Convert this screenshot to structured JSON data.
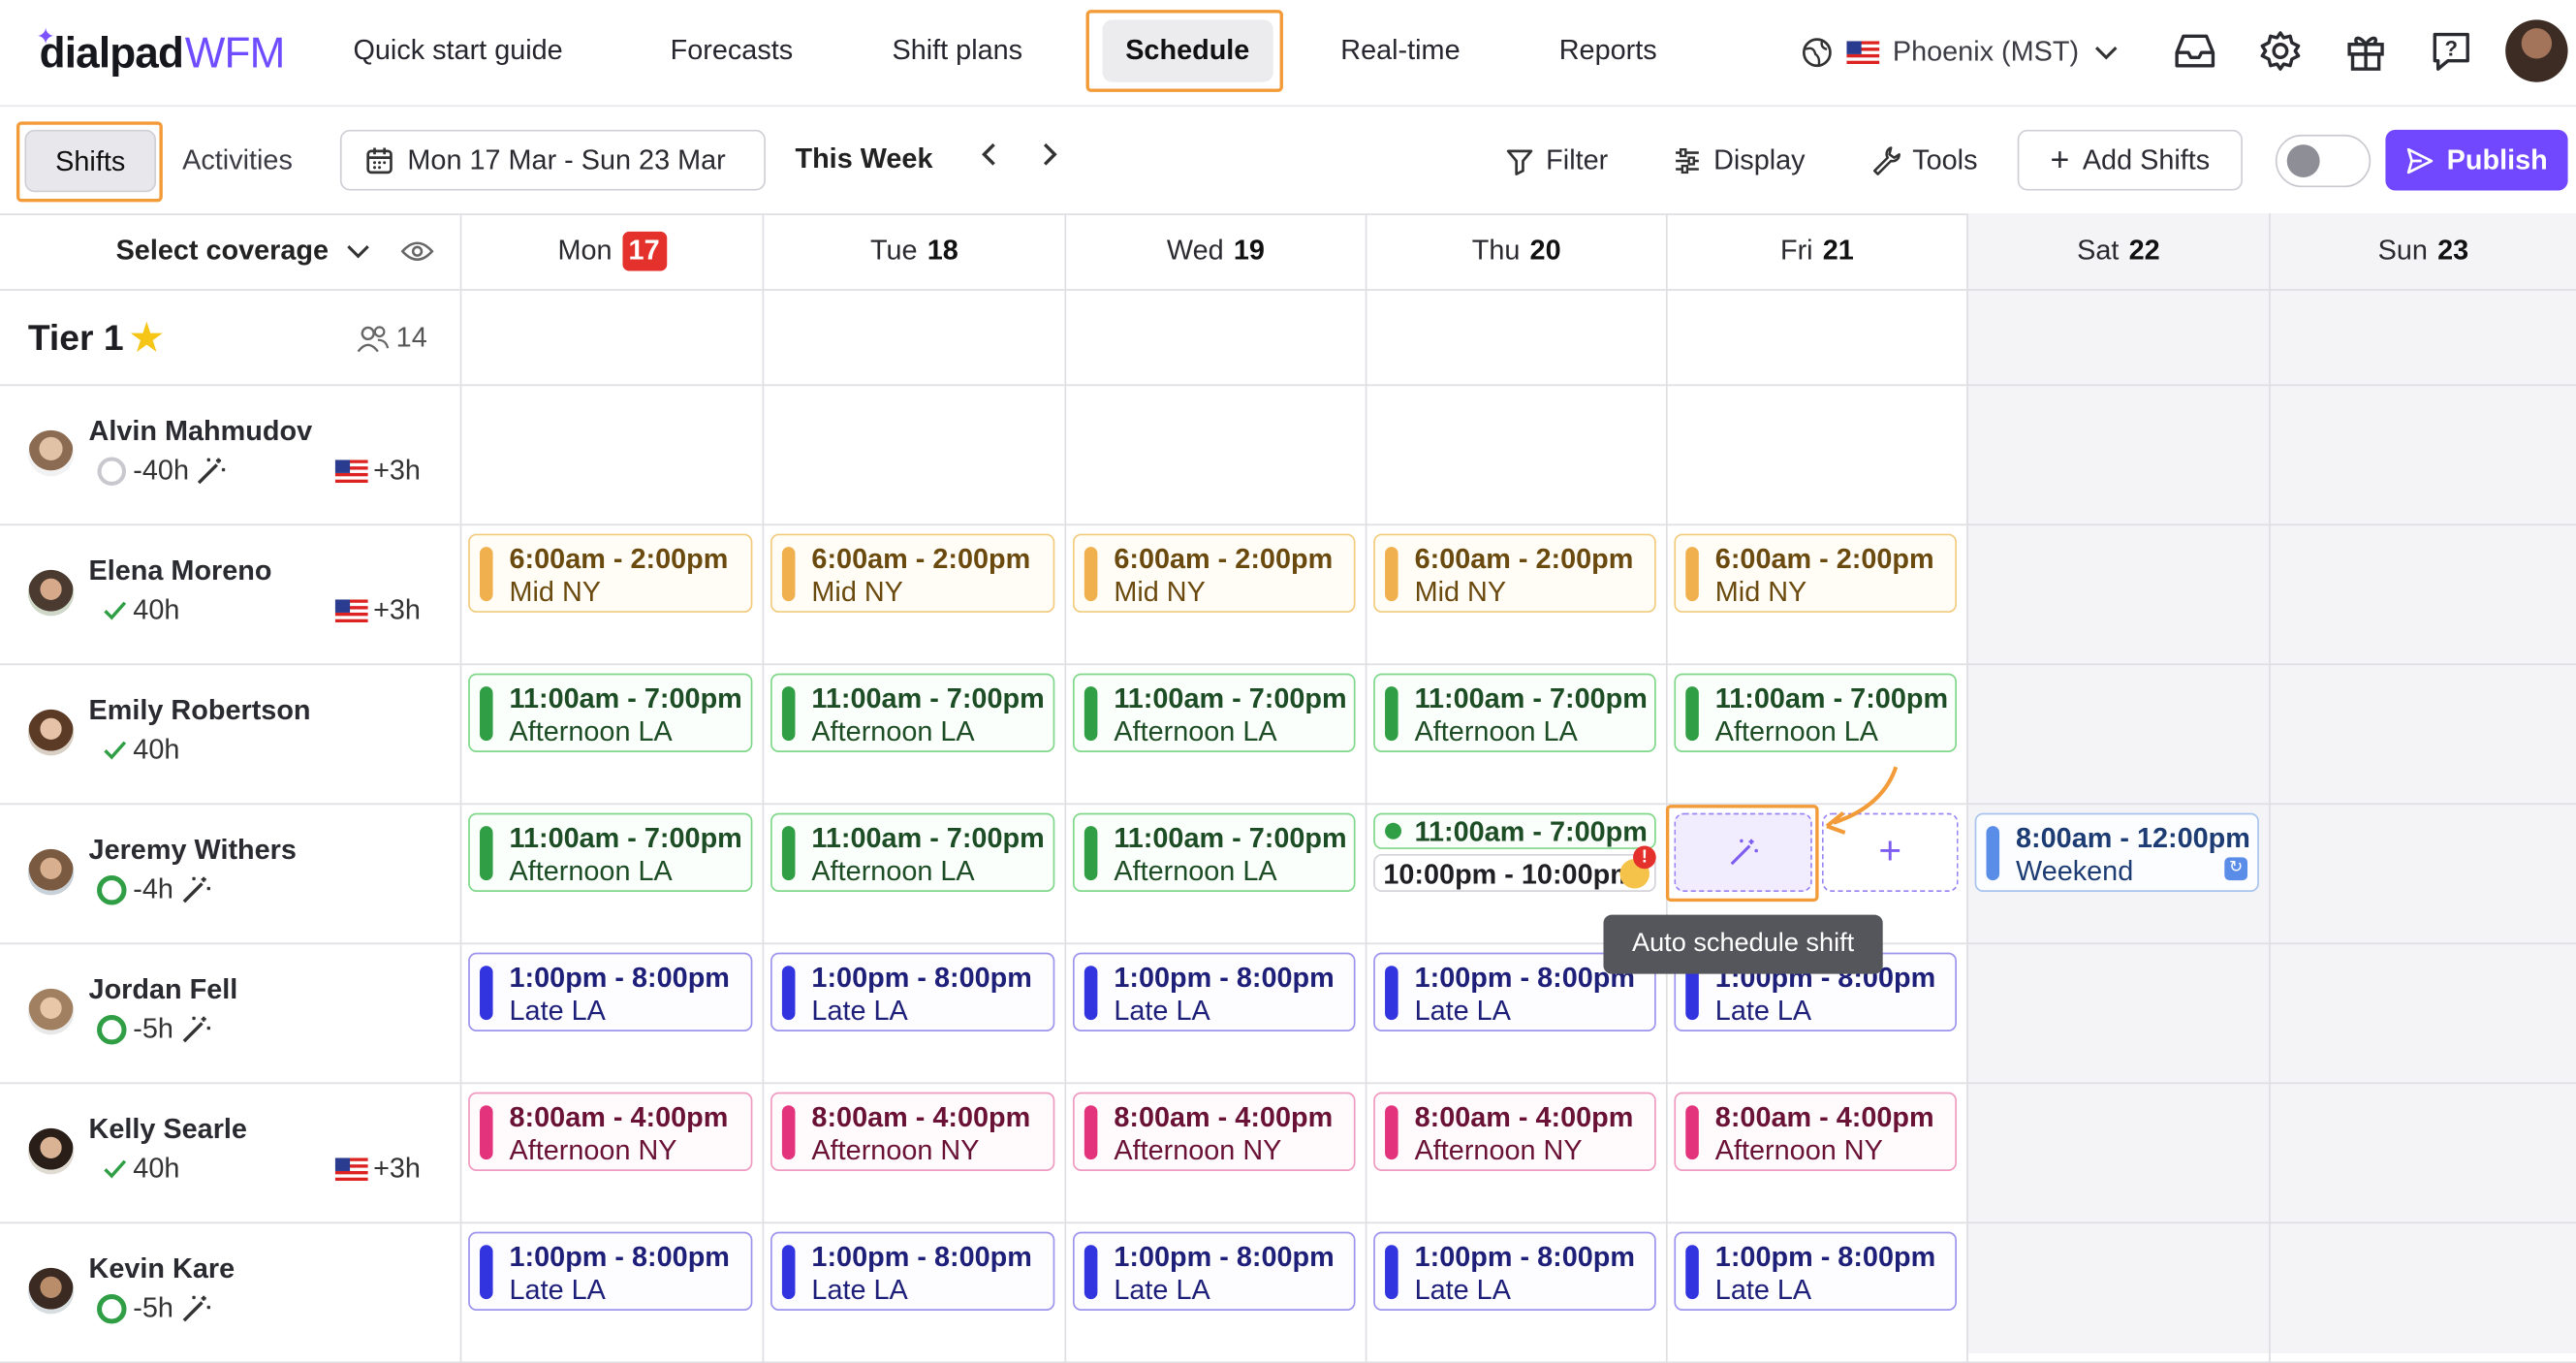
{
  "brand": {
    "part1": "dialpad",
    "part2": "WFM"
  },
  "nav": {
    "items": [
      "Quick start guide",
      "Forecasts",
      "Shift plans",
      "Schedule",
      "Real-time",
      "Reports"
    ],
    "active": "Schedule"
  },
  "timezone": {
    "label": "Phoenix (MST)",
    "icon": "globe-icon"
  },
  "top_icons": [
    "inbox-icon",
    "settings-icon",
    "gift-icon",
    "help-icon",
    "user-avatar"
  ],
  "toolbar": {
    "tabs": [
      "Shifts",
      "Activities"
    ],
    "active_tab": "Shifts",
    "date_range": "Mon 17 Mar - Sun 23 Mar",
    "this_week": "This Week",
    "filter": "Filter",
    "display": "Display",
    "tools": "Tools",
    "add_shifts": "Add Shifts",
    "publish": "Publish"
  },
  "coverage": {
    "label": "Select coverage"
  },
  "days": [
    {
      "name": "Mon",
      "num": "17",
      "today": true
    },
    {
      "name": "Tue",
      "num": "18"
    },
    {
      "name": "Wed",
      "num": "19"
    },
    {
      "name": "Thu",
      "num": "20"
    },
    {
      "name": "Fri",
      "num": "21"
    },
    {
      "name": "Sat",
      "num": "22",
      "weekend": true
    },
    {
      "name": "Sun",
      "num": "23",
      "weekend": true
    }
  ],
  "tier": {
    "name": "Tier 1",
    "count": "14"
  },
  "employees": [
    {
      "name": "Alvin Mahmudov",
      "hours": "-40h",
      "status": "empty",
      "offset": "+3h",
      "autoschedule": true
    },
    {
      "name": "Elena Moreno",
      "hours": "40h",
      "status": "check",
      "offset": "+3h"
    },
    {
      "name": "Emily Robertson",
      "hours": "40h",
      "status": "check"
    },
    {
      "name": "Jeremy Withers",
      "hours": "-4h",
      "status": "ring",
      "autoschedule": true
    },
    {
      "name": "Jordan Fell",
      "hours": "-5h",
      "status": "ring",
      "autoschedule": true
    },
    {
      "name": "Kelly Searle",
      "hours": "40h",
      "status": "check",
      "offset": "+3h"
    },
    {
      "name": "Kevin Kare",
      "hours": "-5h",
      "status": "ring",
      "autoschedule": true
    }
  ],
  "shifts": {
    "mid_ny": {
      "time": "6:00am - 2:00pm",
      "name": "Mid NY"
    },
    "afternoon_la": {
      "time": "11:00am - 7:00pm",
      "name": "Afternoon LA"
    },
    "late_la": {
      "time": "1:00pm - 8:00pm",
      "name": "Late LA"
    },
    "afternoon_ny": {
      "time": "8:00am - 4:00pm",
      "name": "Afternoon NY"
    },
    "weekend": {
      "time": "8:00am - 12:00pm",
      "name": "Weekend"
    },
    "jeremy_thu_second": {
      "time": "10:00pm - 10:00pm"
    }
  },
  "tooltip": "Auto schedule shift",
  "colors": {
    "accent": "#7248ff",
    "highlight": "#f29b38",
    "today": "#e5312b"
  }
}
